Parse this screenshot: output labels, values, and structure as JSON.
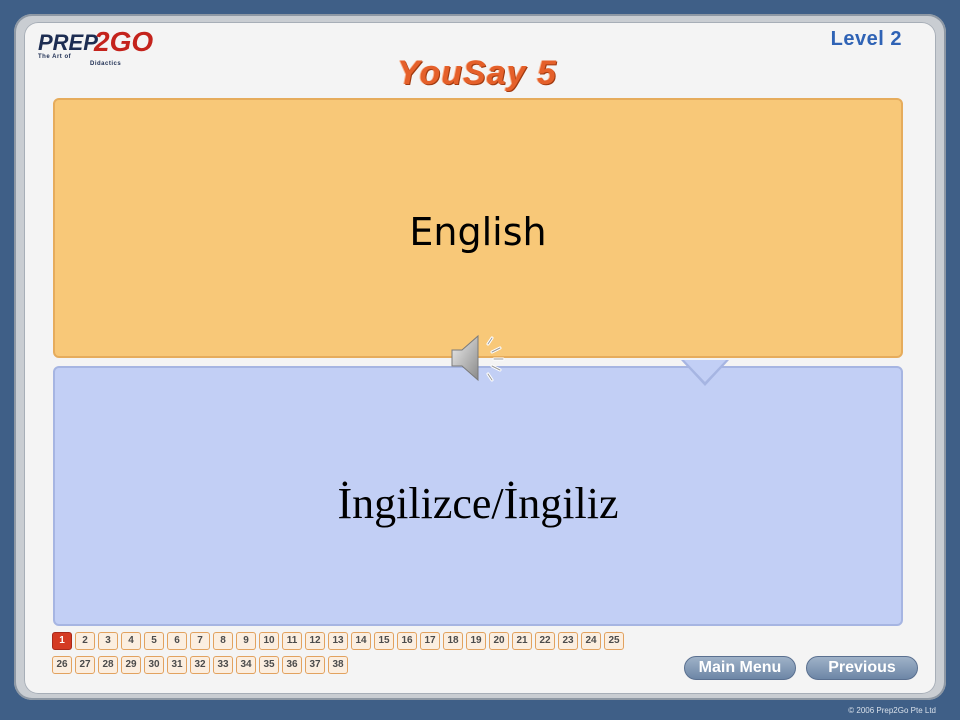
{
  "header": {
    "logo_main": "PREP",
    "logo_suffix": "2GO",
    "logo_tagline": "The Art of",
    "logo_tagline2": "Didactics",
    "title": "YouSay 5",
    "level": "Level 2"
  },
  "card": {
    "english": "English",
    "turkish": "İngilizce/İngiliz"
  },
  "audio": {
    "icon": "speaker-icon"
  },
  "pagination": {
    "current": "1",
    "row1": [
      "1",
      "2",
      "3",
      "4",
      "5",
      "6",
      "7",
      "8",
      "9",
      "10",
      "11",
      "12",
      "13",
      "14",
      "15",
      "16",
      "17",
      "18",
      "19",
      "20",
      "21",
      "22",
      "23",
      "24",
      "25"
    ],
    "row2": [
      "26",
      "27",
      "28",
      "29",
      "30",
      "31",
      "32",
      "33",
      "34",
      "35",
      "36",
      "37",
      "38"
    ]
  },
  "nav": {
    "main_menu": "Main Menu",
    "previous": "Previous"
  },
  "footer": {
    "copyright": "© 2006 Prep2Go Pte Ltd"
  },
  "colors": {
    "background": "#3f5f87",
    "english_card": "#f8c878",
    "translation_card": "#c2cff5",
    "active_page": "#d43a23",
    "level_text": "#2f63b5"
  }
}
